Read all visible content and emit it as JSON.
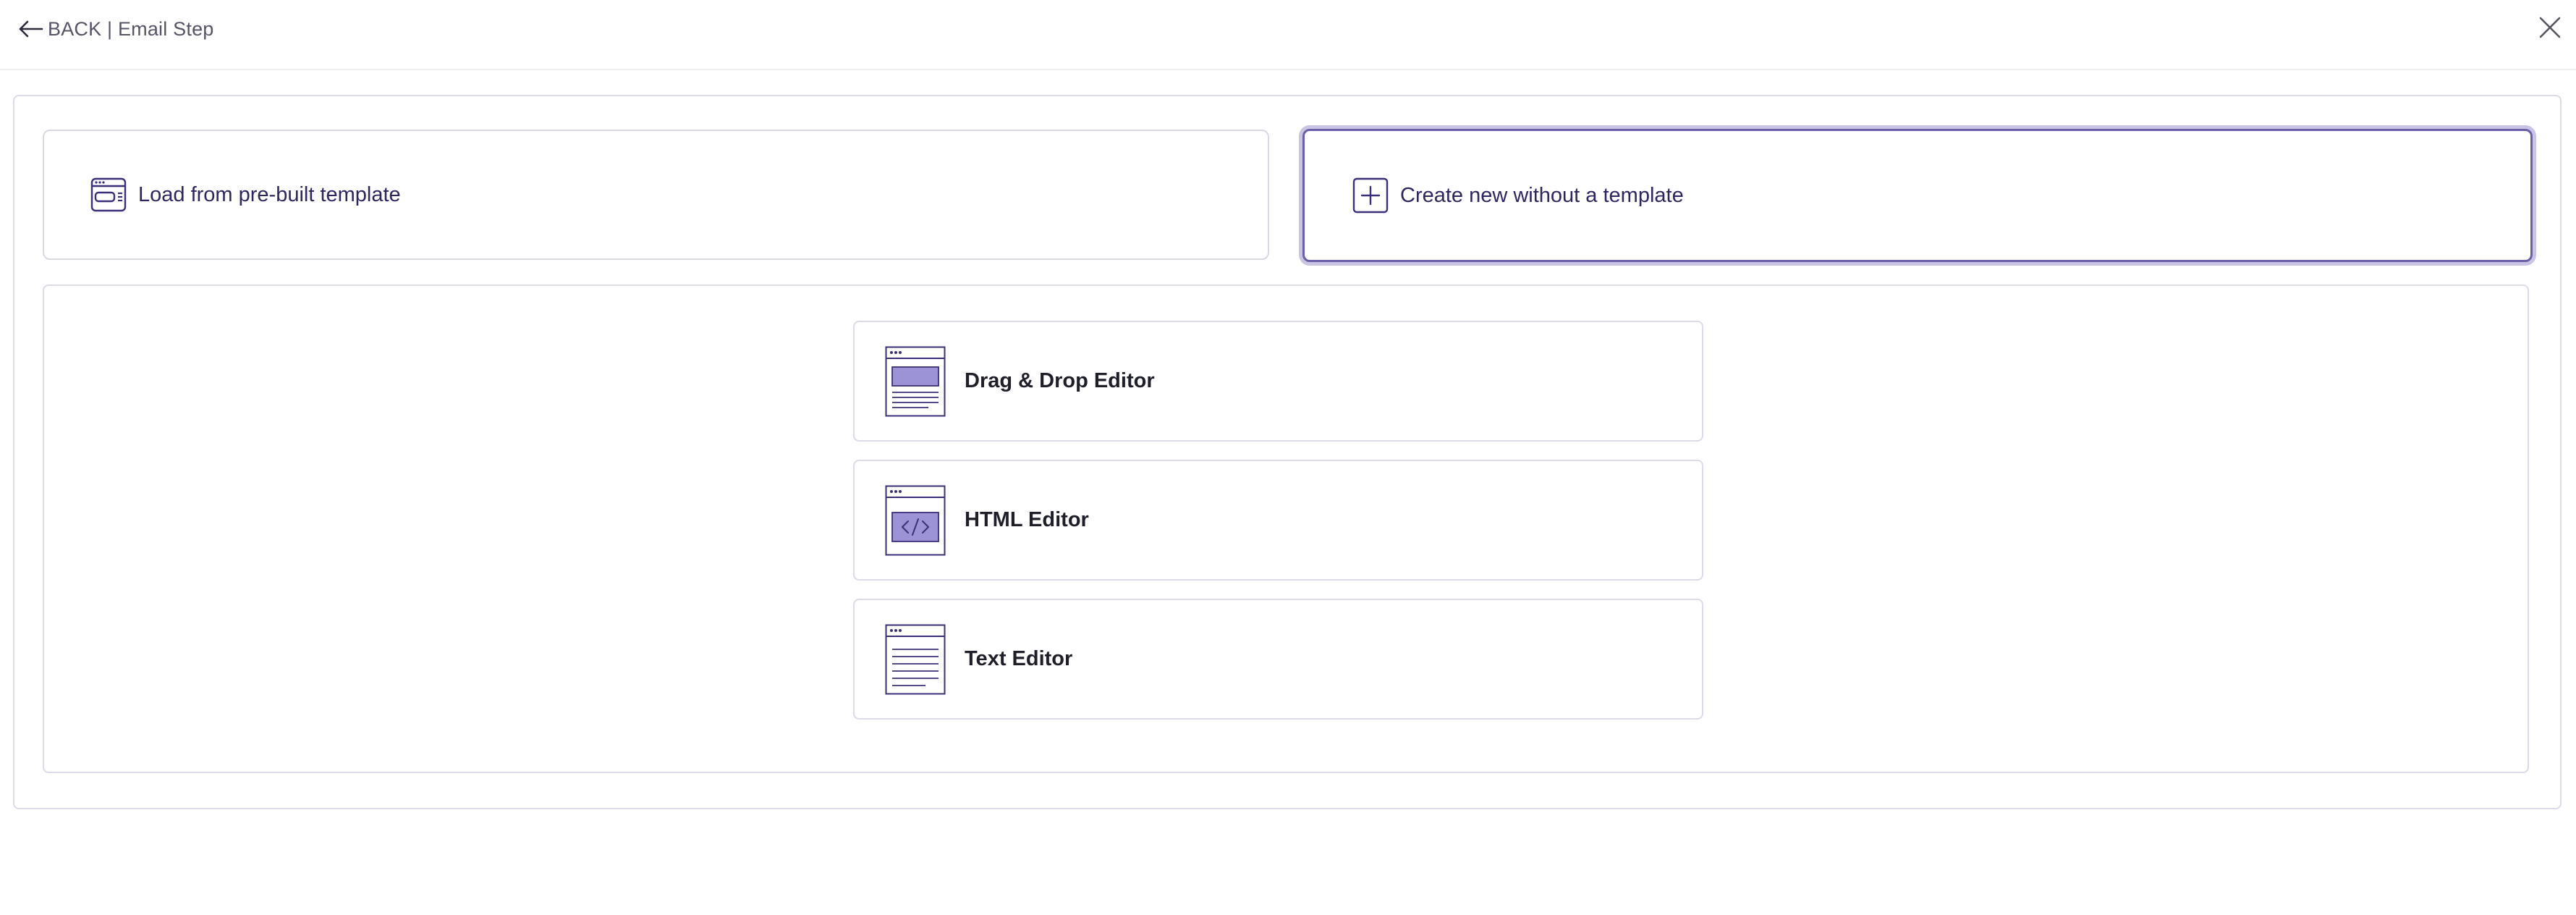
{
  "header": {
    "back_label": "BACK | Email Step",
    "back_icon": "arrow-left-icon",
    "close_icon": "close-icon"
  },
  "template_options": [
    {
      "label": "Load from pre-built template",
      "icon": "template-icon",
      "selected": false
    },
    {
      "label": "Create new without a template",
      "icon": "plus-square-icon",
      "selected": true
    }
  ],
  "editors": [
    {
      "label": "Drag & Drop Editor",
      "icon": "drag-drop-editor-icon"
    },
    {
      "label": "HTML Editor",
      "icon": "html-editor-icon"
    },
    {
      "label": "Text Editor",
      "icon": "text-editor-icon"
    }
  ],
  "colors": {
    "accent": "#3b2f7a",
    "selected_border": "#6a60a8",
    "icon_fill": "#9b93d3",
    "border": "#dcdce8"
  }
}
